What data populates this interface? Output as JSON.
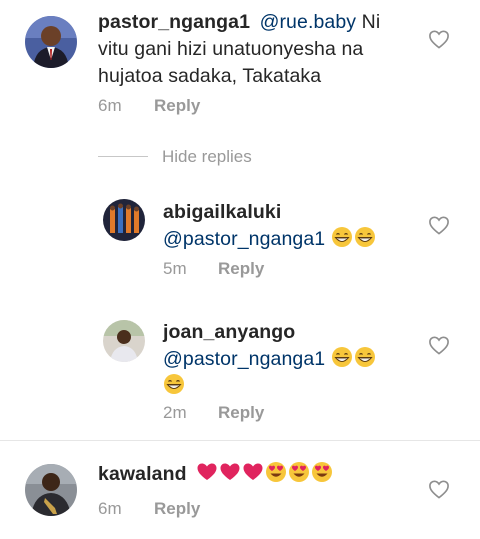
{
  "comments": [
    {
      "username": "pastor_nganga1",
      "mention": "@rue.baby",
      "text_line1_rest": " Ni",
      "text_line2": "vitu gani hizi unatuonyesha na",
      "text_line3": "hujatoa sadaka, Takataka",
      "time": "6m",
      "reply_label": "Reply"
    }
  ],
  "hide_replies_label": "Hide replies",
  "replies": [
    {
      "username": "abigailkaluki",
      "mention": "@pastor_nganga1",
      "emoji_count": 2,
      "time": "5m",
      "reply_label": "Reply"
    },
    {
      "username": "joan_anyango",
      "mention": "@pastor_nganga1",
      "emoji_count": 3,
      "time": "2m",
      "reply_label": "Reply"
    }
  ],
  "last_comment": {
    "username": "kawaland",
    "heart_count": 3,
    "heart_eyes_count": 3,
    "time": "6m",
    "reply_label": "Reply"
  },
  "colors": {
    "mention": "#003569",
    "meta": "#999999",
    "heart_emoji": "#e0245e",
    "emoji_face": "#f7c63b"
  },
  "icons": {
    "like": "heart-outline-icon",
    "grin": "grinning-face-emoji",
    "heart": "pink-heart-emoji",
    "heart_eyes": "heart-eyes-emoji"
  }
}
